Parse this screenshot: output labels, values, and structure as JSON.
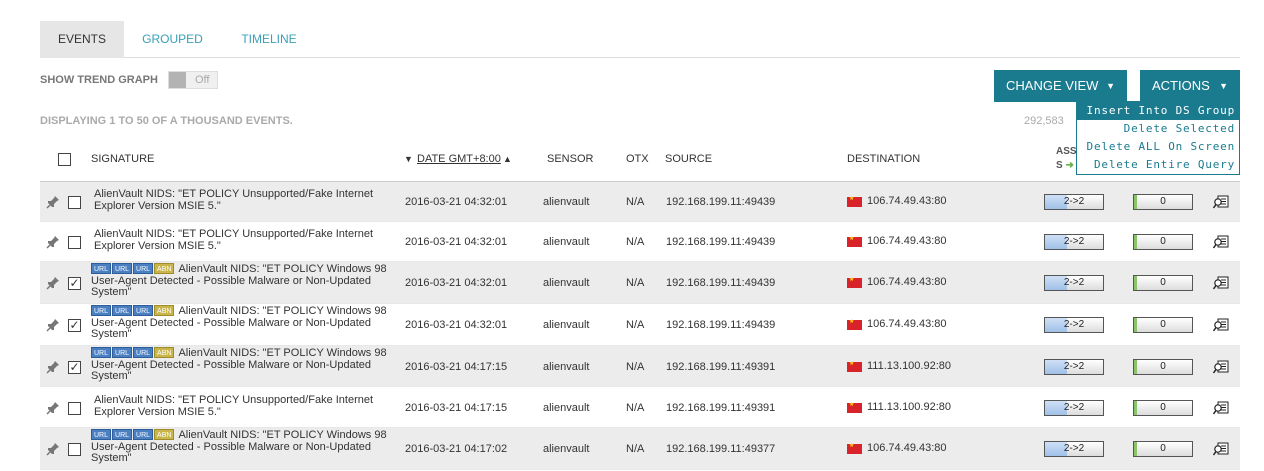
{
  "tabs": [
    {
      "label": "EVENTS",
      "active": true
    },
    {
      "label": "GROUPED",
      "active": false
    },
    {
      "label": "TIMELINE",
      "active": false
    }
  ],
  "trend": {
    "label": "SHOW TREND GRAPH",
    "state": "Off"
  },
  "buttons": {
    "change_view": "CHANGE VIEW",
    "actions": "ACTIONS"
  },
  "actions_menu": [
    "Insert Into DS Group",
    "Delete Selected",
    "Delete ALL On Screen",
    "Delete Entire Query"
  ],
  "display_info": "DISPLAYING 1 TO 50 OF A THOUSAND EVENTS.",
  "total_count": "292,583",
  "headers": {
    "signature": "SIGNATURE",
    "date_sort_desc": "▼",
    "date": "DATE GMT+8:00",
    "date_sort_asc": "▲",
    "sensor": "SENSOR",
    "otx": "OTX",
    "source": "SOURCE",
    "destination": "DESTINATION",
    "ass_line1": "ASS",
    "ass_line2": "S",
    "ass_arrow": "➜"
  },
  "colors": {
    "accent": "#1a7b8f",
    "tab_link": "#39a0b8",
    "flag": "#d8232a"
  },
  "rows": [
    {
      "checked": false,
      "badges": [],
      "signature": "AlienVault NIDS: \"ET POLICY Unsupported/Fake Internet Explorer Version MSIE 5.\"",
      "date": "2016-03-21 04:32:01",
      "sensor": "alienvault",
      "otx": "N/A",
      "source": "192.168.199.11:49439",
      "destination": "106.74.49.43:80",
      "asset": "2->2",
      "risk": "0",
      "shaded": true
    },
    {
      "checked": false,
      "badges": [],
      "signature": "AlienVault NIDS: \"ET POLICY Unsupported/Fake Internet Explorer Version MSIE 5.\"",
      "date": "2016-03-21 04:32:01",
      "sensor": "alienvault",
      "otx": "N/A",
      "source": "192.168.199.11:49439",
      "destination": "106.74.49.43:80",
      "asset": "2->2",
      "risk": "0",
      "shaded": false
    },
    {
      "checked": true,
      "badges": [
        "URL",
        "URL",
        "URL",
        "ABN"
      ],
      "signature": "AlienVault NIDS: \"ET POLICY Windows 98 User-Agent Detected - Possible Malware or Non-Updated System\"",
      "date": "2016-03-21 04:32:01",
      "sensor": "alienvault",
      "otx": "N/A",
      "source": "192.168.199.11:49439",
      "destination": "106.74.49.43:80",
      "asset": "2->2",
      "risk": "0",
      "shaded": true
    },
    {
      "checked": true,
      "badges": [
        "URL",
        "URL",
        "URL",
        "ABN"
      ],
      "signature": "AlienVault NIDS: \"ET POLICY Windows 98 User-Agent Detected - Possible Malware or Non-Updated System\"",
      "date": "2016-03-21 04:32:01",
      "sensor": "alienvault",
      "otx": "N/A",
      "source": "192.168.199.11:49439",
      "destination": "106.74.49.43:80",
      "asset": "2->2",
      "risk": "0",
      "shaded": false
    },
    {
      "checked": true,
      "badges": [
        "URL",
        "URL",
        "URL",
        "ABN"
      ],
      "signature": "AlienVault NIDS: \"ET POLICY Windows 98 User-Agent Detected - Possible Malware or Non-Updated System\"",
      "date": "2016-03-21 04:17:15",
      "sensor": "alienvault",
      "otx": "N/A",
      "source": "192.168.199.11:49391",
      "destination": "111.13.100.92:80",
      "asset": "2->2",
      "risk": "0",
      "shaded": true
    },
    {
      "checked": false,
      "badges": [],
      "signature": "AlienVault NIDS: \"ET POLICY Unsupported/Fake Internet Explorer Version MSIE 5.\"",
      "date": "2016-03-21 04:17:15",
      "sensor": "alienvault",
      "otx": "N/A",
      "source": "192.168.199.11:49391",
      "destination": "111.13.100.92:80",
      "asset": "2->2",
      "risk": "0",
      "shaded": false
    },
    {
      "checked": false,
      "badges": [
        "URL",
        "URL",
        "URL",
        "ABN"
      ],
      "signature": "AlienVault NIDS: \"ET POLICY Windows 98 User-Agent Detected - Possible Malware or Non-Updated System\"",
      "date": "2016-03-21 04:17:02",
      "sensor": "alienvault",
      "otx": "N/A",
      "source": "192.168.199.11:49377",
      "destination": "106.74.49.43:80",
      "asset": "2->2",
      "risk": "0",
      "shaded": true
    }
  ]
}
